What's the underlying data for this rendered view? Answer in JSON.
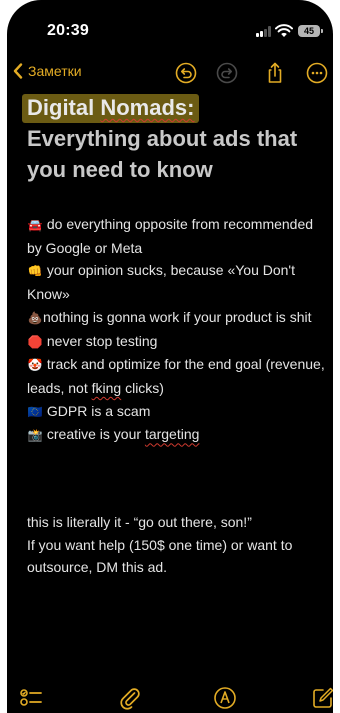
{
  "status_bar": {
    "time": "20:39",
    "battery": "45"
  },
  "nav": {
    "back_label": "Заметки"
  },
  "note": {
    "title_line1": "Digital",
    "title_line1_b": "Nomads:",
    "title_rest": "Everything about ads that you need to know",
    "bullets": [
      {
        "icon": "🚘",
        "text": "do everything opposite from recommended by Google or Meta"
      },
      {
        "icon": "👊",
        "text": "your opinion sucks, because «You Don't Know»"
      },
      {
        "icon": "💩",
        "text": "nothing is gonna work if your product is shit"
      },
      {
        "icon": "🛑",
        "text": "never stop testing"
      },
      {
        "icon": "🤡",
        "text": "track and optimize for the end goal (revenue, leads, not",
        "text_b": "fking",
        "text_c": "clicks)"
      },
      {
        "icon": "🇪🇺",
        "text": "GDPR is a scam"
      },
      {
        "icon": "📸",
        "text": "creative is your",
        "text_b": "targeting"
      }
    ],
    "closing_1": "this is literally it - “go out there, son!”",
    "closing_2": "If you want help (150$ one time) or want to outsource, DM this ad."
  },
  "colors": {
    "accent": "#e3ac25",
    "background": "#000000",
    "highlight": "#6b5b13"
  }
}
